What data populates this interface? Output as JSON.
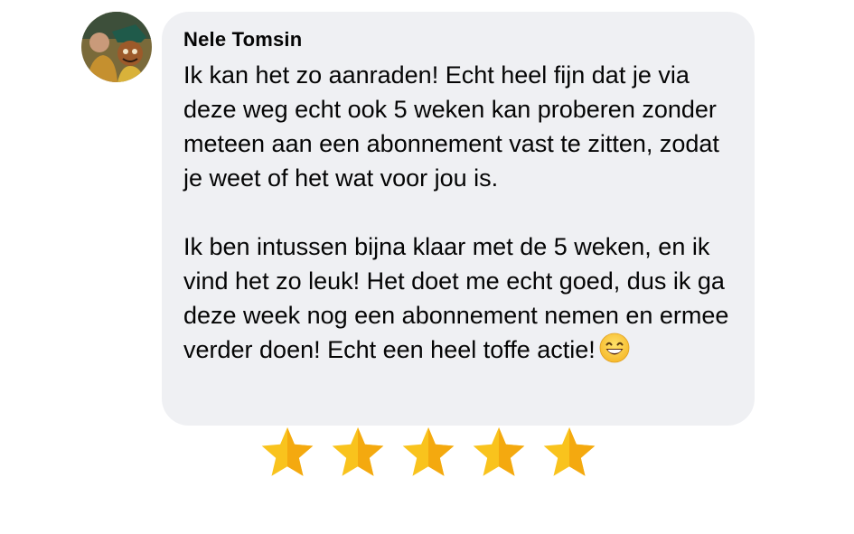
{
  "review": {
    "author_name": "Nele Tomsin",
    "paragraphs": [
      "Ik kan het zo aanraden! Echt heel fijn dat je via deze weg echt ook 5 weken kan proberen zonder meteen aan een abonnement vast te zitten, zodat je weet of het wat voor jou is.",
      "Ik ben intussen bijna klaar met de 5 weken, en ik vind het zo leuk! Het doet me echt goed, dus ik ga deze week nog een abonnement nemen en ermee verder doen! Echt een heel toffe actie!"
    ],
    "emoji": "grinning-face-with-smiling-eyes",
    "rating": {
      "value": 5,
      "max": 5
    }
  },
  "colors": {
    "bubble_background": "#eff0f3",
    "text": "#050505",
    "star_fill": "#f9c31d",
    "star_shade": "#f4a90f"
  }
}
